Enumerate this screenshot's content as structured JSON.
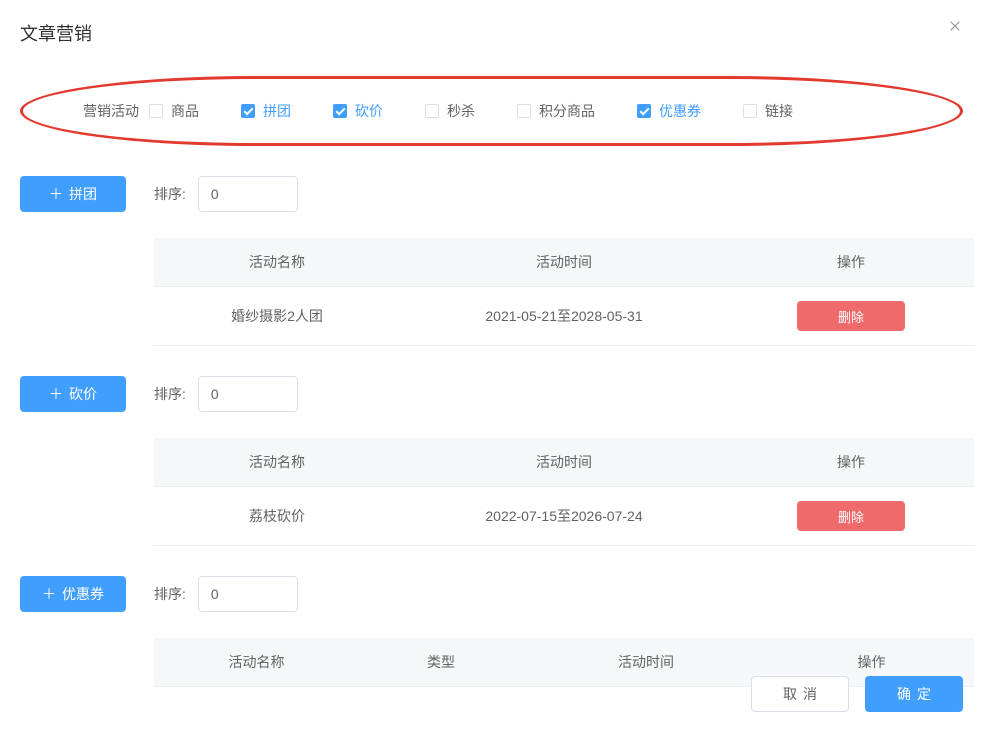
{
  "title": "文章营销",
  "activityLabel": "营销活动",
  "checkboxes": [
    {
      "key": "goods",
      "label": "商品",
      "checked": false
    },
    {
      "key": "pintuan",
      "label": "拼团",
      "checked": true
    },
    {
      "key": "kanjia",
      "label": "砍价",
      "checked": true
    },
    {
      "key": "miaosha",
      "label": "秒杀",
      "checked": false
    },
    {
      "key": "jifen",
      "label": "积分商品",
      "checked": false
    },
    {
      "key": "coupon",
      "label": "优惠券",
      "checked": true
    },
    {
      "key": "link",
      "label": "链接",
      "checked": false
    }
  ],
  "sortLabel": "排序:",
  "plus": "＋",
  "sections": {
    "pintuan": {
      "addLabel": "拼团",
      "sortValue": "0",
      "columns": {
        "name": "活动名称",
        "time": "活动时间",
        "ops": "操作"
      },
      "rows": [
        {
          "name": "婚纱摄影2人团",
          "time": "2021-05-21至2028-05-31"
        }
      ]
    },
    "kanjia": {
      "addLabel": "砍价",
      "sortValue": "0",
      "columns": {
        "name": "活动名称",
        "time": "活动时间",
        "ops": "操作"
      },
      "rows": [
        {
          "name": "荔枝砍价",
          "time": "2022-07-15至2026-07-24"
        }
      ]
    },
    "coupon": {
      "addLabel": "优惠券",
      "sortValue": "0",
      "columns": {
        "name": "活动名称",
        "type": "类型",
        "time": "活动时间",
        "ops": "操作"
      },
      "rows": []
    }
  },
  "deleteLabel": "删除",
  "footer": {
    "cancel": "取消",
    "confirm": "确定"
  }
}
